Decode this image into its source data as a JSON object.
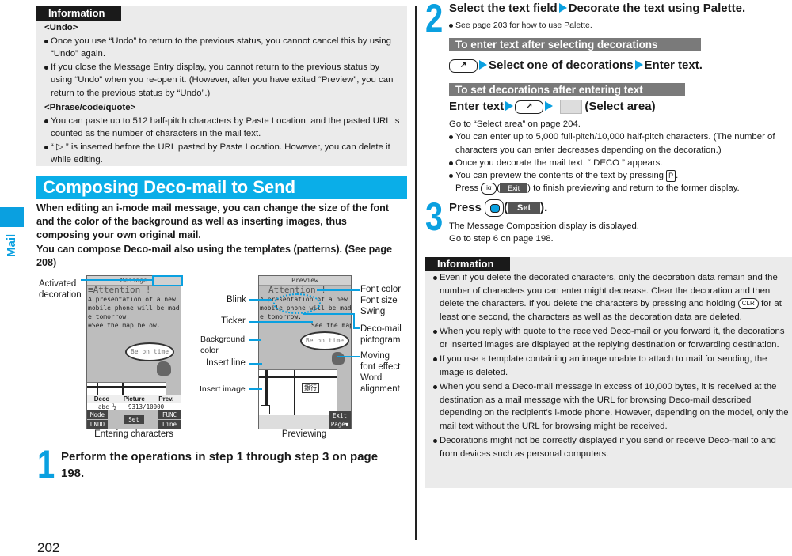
{
  "side_tab": {
    "label": "Mail",
    "color": "#0aa0e0"
  },
  "page_number": "202",
  "info_top": {
    "header": "Information",
    "sections": [
      {
        "title": "<Undo>",
        "bullets": [
          "Once you use “Undo” to return to the previous status, you cannot cancel this by using “Undo” again.",
          "If you close the Message Entry display, you cannot return to the previous status by using “Undo” when you re-open it. (However, after you have exited “Preview”, you can return to the previous status by “Undo”.)"
        ]
      },
      {
        "title": "<Phrase/code/quote>",
        "bullets": [
          "You can paste up to 512 half-pitch characters by Paste Location, and the pasted URL is counted as the number of characters in the mail text.",
          "“ ▷ ” is inserted before the URL pasted by Paste Location. However, you can delete it while editing."
        ]
      }
    ]
  },
  "section": {
    "title": "Composing Deco-mail to Send",
    "intro_1": "When editing an i-mode mail message, you can change the size of the font and the color of the background as well as inserting images, thus composing your own original mail.",
    "intro_2": "You can compose Deco-mail also using the templates (patterns). (See page 208)"
  },
  "figure": {
    "entering": {
      "caption": "Entering characters",
      "status_title": "Message",
      "lines": [
        "≡Attention !",
        "A presentation of a new",
        "mobile phone will be mad",
        "e tomorrow.",
        "≡See the map below."
      ],
      "bubble": "Be on time",
      "softbar": [
        "Deco",
        "Picture",
        "Prev."
      ],
      "counter": "9313/10000",
      "input_mode": "abc ½",
      "keys": {
        "mode": "Mode",
        "undo": "UNDO",
        "set": "Set",
        "func": "FUNC",
        "linefd": "Line FD"
      },
      "callout": "Activated decoration"
    },
    "preview": {
      "caption": "Previewing",
      "status_title": "Preview",
      "lines": [
        "Attention !",
        "A presentation of a new",
        "mobile phone will be mad",
        "e tomorrow.",
        "See the map"
      ],
      "bubble": "Be on time",
      "map_sign": "銀行",
      "keys": {
        "exit": "Exit",
        "page": "Page▼"
      },
      "left_labels": [
        "Blink",
        "Ticker",
        "Background color",
        "Insert line",
        "Insert image"
      ],
      "right_labels": [
        "Font color\nFont size\nSwing",
        "Deco-mail pictogram",
        "Moving font effect Word alignment"
      ]
    }
  },
  "step1": {
    "num": "1",
    "text": "Perform the operations in step 1 through step 3 on page 198."
  },
  "step2": {
    "num": "2",
    "text_a": "Select the text field",
    "text_b": "Decorate the text using Palette.",
    "note": "See page 203 for how to use Palette.",
    "sub1": {
      "title": "To enter text after selecting decorations",
      "a": "Select one of decorations",
      "b": "Enter text."
    },
    "sub2": {
      "title": "To set decorations after entering text",
      "a": "Enter text",
      "b": "(Select area)"
    },
    "goto": "Go to “Select area” on page 204.",
    "bullets": [
      "You can enter up to 5,000 full-pitch/10,000 half-pitch characters. (The number of characters you can enter decreases depending on the decoration.)",
      "Once you decorate the mail text, “ DECO ” appears.",
      "You can preview the contents of the text by pressing"
    ],
    "press_line": "to finish previewing and return to the former display.",
    "press_word": "Press",
    "exit_key": "Exit"
  },
  "step3": {
    "num": "3",
    "press": "Press",
    "set_key": "Set",
    "lines": [
      "The Message Composition display is displayed.",
      "Go to step 6 on page 198."
    ]
  },
  "info_bottom": {
    "header": "Information",
    "clr_key": "CLR",
    "bullets": [
      "Even if you delete the decorated characters, only the decoration data remain and the number of characters you can enter might decrease. Clear the decoration and then delete the characters. If you delete the characters by pressing and holding",
      "for at least one second, the characters as well as the decoration data are deleted.",
      "When you reply with quote to the received Deco-mail or you forward it, the decorations or inserted images are displayed at the replying destination or forwarding destination.",
      "If you use a template containing an image unable to attach to mail for sending, the image is deleted.",
      "When you send a Deco-mail message in excess of 10,000 bytes, it is received at the destination as a mail message with the URL for browsing Deco-mail described depending on the recipient’s i-mode phone. However, depending on the model, only the mail text without the URL for browsing might be received.",
      "Decorations might not be correctly displayed if you send or receive Deco-mail to and from devices such as personal computers."
    ]
  }
}
